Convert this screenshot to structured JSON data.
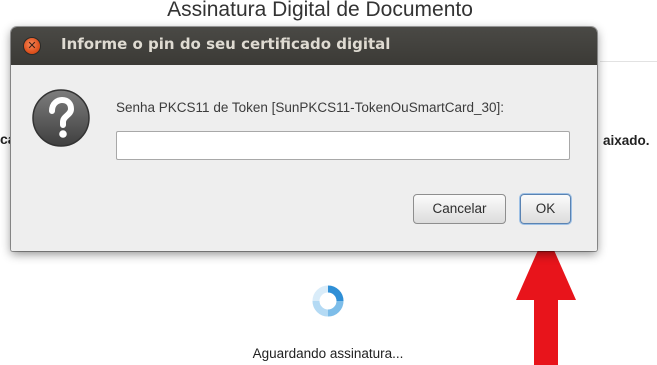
{
  "page": {
    "title": "Assinatura Digital de Documento",
    "left_fragment": "ca",
    "right_fragment": "aixado.",
    "status_text": "Aguardando assinatura..."
  },
  "dialog": {
    "title": "Informe o pin do seu certificado digital",
    "close_icon": "close-icon",
    "prompt": "Senha PKCS11 de Token [SunPKCS11-TokenOuSmartCard_30]:",
    "pin_value": "",
    "cancel_label": "Cancelar",
    "ok_label": "OK",
    "icon": "question-icon"
  },
  "colors": {
    "titlebar": "#3c3b37",
    "close_button": "#e0531f",
    "dialog_body": "#eeeeee",
    "spinner_blue": "#2f8fd6",
    "annotation_arrow": "#e8141b"
  }
}
